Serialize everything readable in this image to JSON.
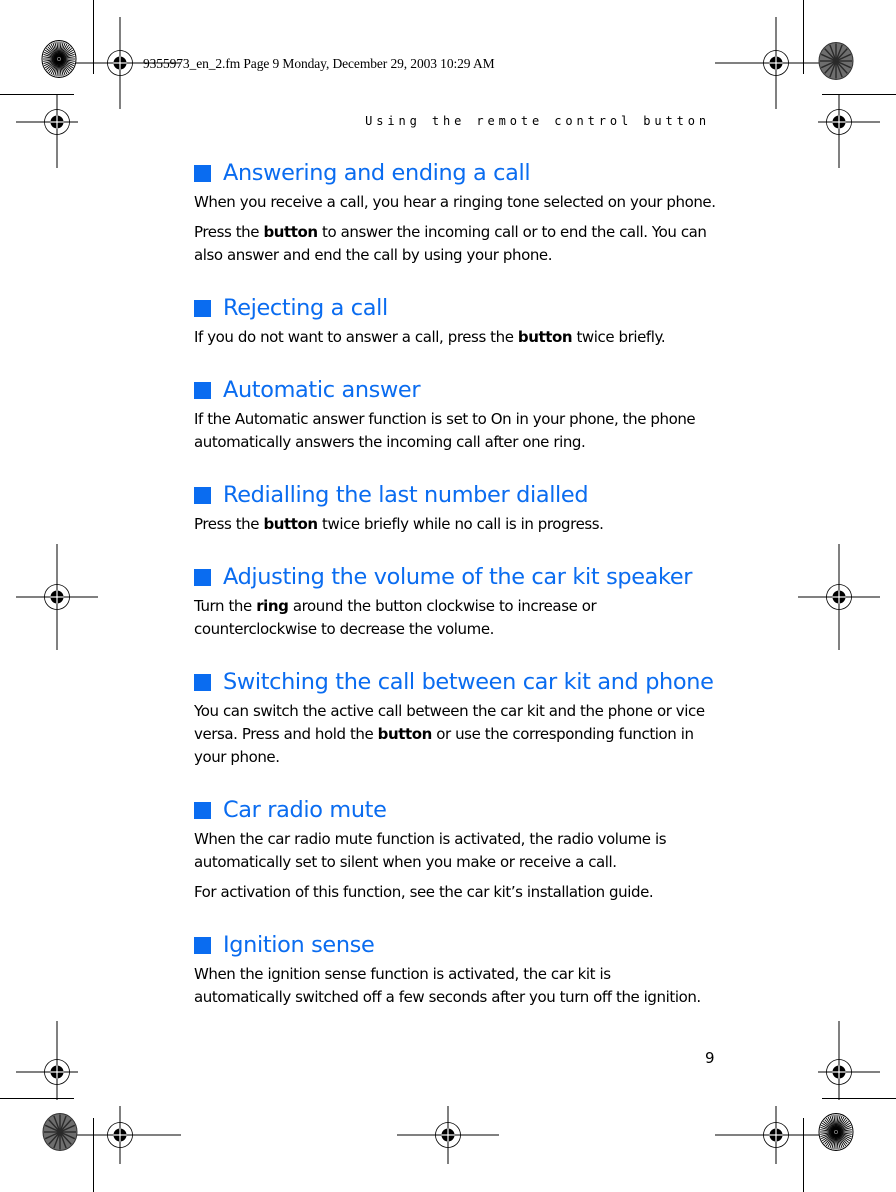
{
  "slug": "9355973_en_2.fm  Page 9  Monday, December 29, 2003  10:29 AM",
  "running_head": "Using the remote control button",
  "accent_color": "#0a6cf0",
  "page_number": "9",
  "sections": [
    {
      "title": "Answering and ending a call",
      "paragraphs": [
        [
          {
            "t": "When you receive a call, you hear a ringing tone selected on your phone."
          }
        ],
        [
          {
            "t": "Press the "
          },
          {
            "t": "button",
            "b": true
          },
          {
            "t": " to answer the incoming call or to end the call. You can"
          },
          {
            "br": true
          },
          {
            "t": "also answer and end the call by using your phone."
          }
        ]
      ]
    },
    {
      "title": "Rejecting a call",
      "paragraphs": [
        [
          {
            "t": "If you do not want to answer a call, press the "
          },
          {
            "t": "button",
            "b": true
          },
          {
            "t": " twice briefly."
          }
        ]
      ]
    },
    {
      "title": "Automatic answer",
      "paragraphs": [
        [
          {
            "t": "If the Automatic answer function is set to On in your phone, the phone"
          },
          {
            "br": true
          },
          {
            "t": "automatically answers the incoming call after one ring."
          }
        ]
      ]
    },
    {
      "title": "Redialling the last number dialled",
      "paragraphs": [
        [
          {
            "t": "Press the "
          },
          {
            "t": "button",
            "b": true
          },
          {
            "t": " twice briefly while no call is in progress."
          }
        ]
      ]
    },
    {
      "title": "Adjusting the volume of the car kit speaker",
      "paragraphs": [
        [
          {
            "t": "Turn the "
          },
          {
            "t": "ring",
            "b": true
          },
          {
            "t": " around the button clockwise to increase or"
          },
          {
            "br": true
          },
          {
            "t": "counterclockwise to decrease the volume."
          }
        ]
      ]
    },
    {
      "title": "Switching the call between car kit and phone",
      "paragraphs": [
        [
          {
            "t": "You can switch the active call between the car kit and the phone or vice"
          },
          {
            "br": true
          },
          {
            "t": "versa. Press and hold the "
          },
          {
            "t": "button",
            "b": true
          },
          {
            "t": " or use the corresponding function in"
          },
          {
            "br": true
          },
          {
            "t": "your phone."
          }
        ]
      ]
    },
    {
      "title": "Car radio mute",
      "paragraphs": [
        [
          {
            "t": "When the car radio mute function is activated, the radio volume is"
          },
          {
            "br": true
          },
          {
            "t": "automatically set to silent when you make or receive a call."
          }
        ],
        [
          {
            "t": "For activation of this function, see the car kit’s installation guide."
          }
        ]
      ]
    },
    {
      "title": "Ignition sense",
      "paragraphs": [
        [
          {
            "t": "When the ignition sense function is activated, the car kit is"
          },
          {
            "br": true
          },
          {
            "t": "automatically switched off a few seconds after you turn off the ignition."
          }
        ]
      ]
    }
  ]
}
